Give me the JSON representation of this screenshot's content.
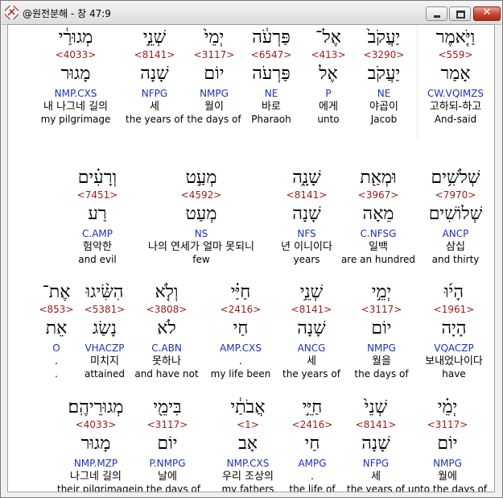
{
  "window": {
    "title": "@원전분해 - 창 47:9",
    "close_glyph": "✕"
  },
  "rows": [
    [
      {
        "heb": "וַיֹּ֤אמֶר",
        "strong": "<559>",
        "lex": "אָמַר",
        "morph": "CW.VQIMZS",
        "kor": "고하되-하고",
        "eng": "And-said",
        "selected": true
      },
      {
        "heb": "יַעֲקֹב֙",
        "strong": "<3290>",
        "lex": "יַעֲקֹב",
        "morph": "NE",
        "kor": "야곱이",
        "eng": "Jacob"
      },
      {
        "heb": "אֶל־",
        "strong": "<413>",
        "lex": "אֶל",
        "morph": "P",
        "kor": "에게",
        "eng": "unto"
      },
      {
        "heb": "פַּרְעֹ֔ה",
        "strong": "<6547>",
        "lex": "פַּרְעֹה",
        "morph": "NE",
        "kor": "바로",
        "eng": "Pharaoh"
      },
      {
        "heb": "יְמֵי֙",
        "strong": "<3117>",
        "lex": "יוֹם",
        "morph": "NMPG",
        "kor": "월이",
        "eng": "the days of"
      },
      {
        "heb": "שְׁנֵ֣י",
        "strong": "<8141>",
        "lex": "שָׁנָה",
        "morph": "NFPG",
        "kor": "세",
        "eng": "the years of"
      },
      {
        "heb": "מְגוּרַ֔י",
        "strong": "<4033>",
        "lex": "מָגוּר",
        "morph": "NMP.CXS",
        "kor": "내 나그네 길의",
        "eng": "my pilgrimage"
      }
    ],
    [
      {
        "heb": "שְׁלֹשִׁ֥ים",
        "strong": "<7970>",
        "lex": "שְׁלוֹשִׁים",
        "morph": "ANCP",
        "kor": "삼십",
        "eng": "and thirty"
      },
      {
        "heb": "וּמְאַ֖ת",
        "strong": "<3967>",
        "lex": "מֵאָה",
        "morph": "C.NFSG",
        "kor": "일백",
        "eng": "are an hundred"
      },
      {
        "heb": "שָׁנָ֑ה",
        "strong": "<8141>",
        "lex": "שָׁנָה",
        "morph": "NFS",
        "kor": "년 이니이다",
        "eng": "years"
      },
      {
        "heb": "מְעַ֣ט",
        "strong": "<4592>",
        "lex": "מְעַט",
        "morph": "NS",
        "kor": "나의 연세가 얼마 못되니",
        "eng": "few"
      },
      {
        "heb": "וְרָעִ֗ים",
        "strong": "<7451>",
        "lex": "רַע",
        "morph": "C.AMP",
        "kor": "험악한",
        "eng": "and evil"
      }
    ],
    [
      {
        "heb": "הָי֜וּ",
        "strong": "<1961>",
        "lex": "הָיָה",
        "morph": "VQACZP",
        "kor": "보내었나이다",
        "eng": "have"
      },
      {
        "heb": "יְמֵ֣י",
        "strong": "<3117>",
        "lex": "יוֹם",
        "morph": "NMPG",
        "kor": "월을",
        "eng": "the days of"
      },
      {
        "heb": "שְׁנֵ֣י",
        "strong": "<8141>",
        "lex": "שָׁנָה",
        "morph": "ANCG",
        "kor": "세",
        "eng": "the years of"
      },
      {
        "heb": "חַיַּ֗י",
        "strong": "<2416>",
        "lex": "חַי",
        "morph": "AMP.CXS",
        "kor": ".",
        "eng": "my life been"
      },
      {
        "heb": "וְלֹ֤א",
        "strong": "<3808>",
        "lex": "לֹא",
        "morph": "C.ABN",
        "kor": "못하나",
        "eng": "and have not"
      },
      {
        "heb": "הִשִּׂ֨יגוּ",
        "strong": "<5381>",
        "lex": "נָשַׂג",
        "morph": "VHACZP",
        "kor": "미치지",
        "eng": "attained"
      },
      {
        "heb": "אֶת־",
        "strong": "<853>",
        "lex": "אֵת",
        "morph": "O",
        "kor": ".",
        "eng": "."
      }
    ],
    [
      {
        "heb": "יְמֵ֗י",
        "strong": "<3117>",
        "lex": "יוֹם",
        "morph": "NMPG",
        "kor": "월에",
        "eng": "unto the days of"
      },
      {
        "heb": "שְׁנֵי֙",
        "strong": "<8141>",
        "lex": "שָׁנָה",
        "morph": "NFPG",
        "kor": "세",
        "eng": "the years of"
      },
      {
        "heb": "חַיֵּ֣י",
        "strong": "<2416>",
        "lex": "חַי",
        "morph": "AMPG",
        "kor": ".",
        "eng": "the life of"
      },
      {
        "heb": "אֲבֹתַ֔י",
        "strong": "<1>",
        "lex": "אָב",
        "morph": "NMP.CXS",
        "kor": "우리 조상의",
        "eng": "my fathers"
      },
      {
        "heb": "בִּימֵ֖י",
        "strong": "<3117>",
        "lex": "יוֹם",
        "morph": "P.NMPG",
        "kor": "날에",
        "eng": "in the days of"
      },
      {
        "heb": "מְגוּרֵיהֶֽם׃",
        "strong": "<4033>",
        "lex": "מָגוּר",
        "morph": "NMP.MZP",
        "kor": "나그네 길의",
        "eng": "their pilgrimage"
      }
    ]
  ]
}
